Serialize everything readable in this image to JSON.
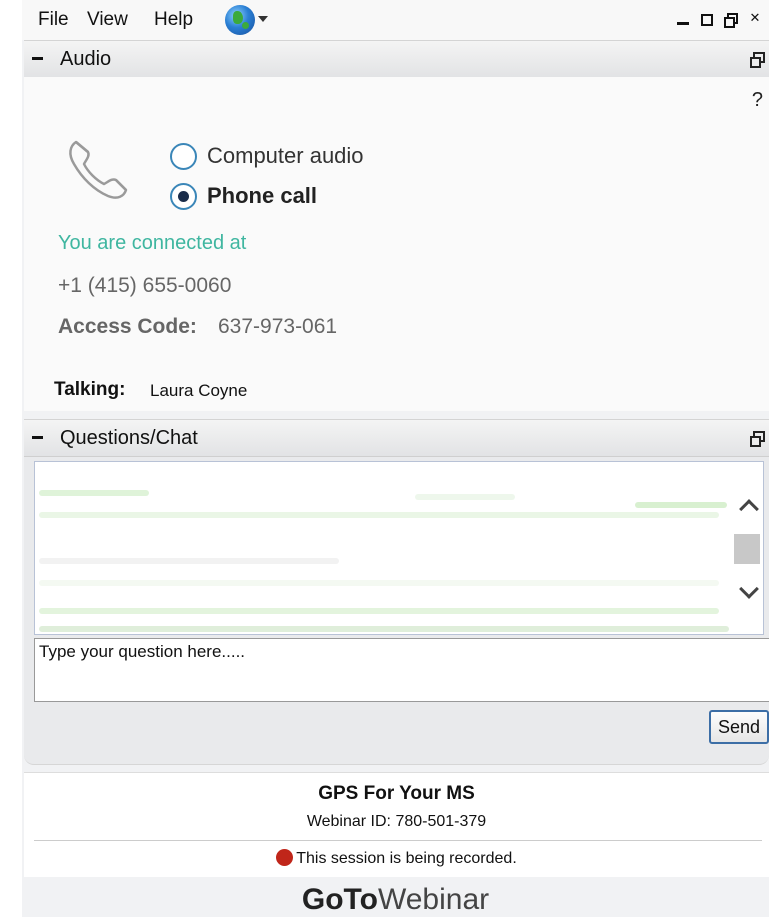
{
  "menu": {
    "file": "File",
    "view": "View",
    "help": "Help"
  },
  "icons": {
    "language": "globe-icon",
    "phone": "phone-icon",
    "recording": "record-dot-icon"
  },
  "audio_panel": {
    "title": "Audio",
    "help": "?",
    "options": [
      {
        "label": "Computer audio",
        "selected": false
      },
      {
        "label": "Phone call",
        "selected": true
      }
    ],
    "connected_text": "You are connected at",
    "phone_number": "+1 (415) 655-0060",
    "access_code_label": "Access Code:",
    "access_code": "637-973-061",
    "talking_label": "Talking:",
    "talking_name": "Laura Coyne"
  },
  "chat_panel": {
    "title": "Questions/Chat",
    "input_placeholder": "Type your question here.....",
    "send_label": "Send"
  },
  "session": {
    "title": "GPS For Your MS",
    "webinar_id": "Webinar ID: 780-501-379",
    "recording_notice": "This session is being recorded."
  },
  "brand": {
    "bold": "GoTo",
    "light": "Webinar"
  },
  "colors": {
    "connected_text": "#3fb6a0",
    "radio_border": "#3a86b8",
    "recording_dot": "#c0261a",
    "send_border": "#3c6ea6"
  }
}
